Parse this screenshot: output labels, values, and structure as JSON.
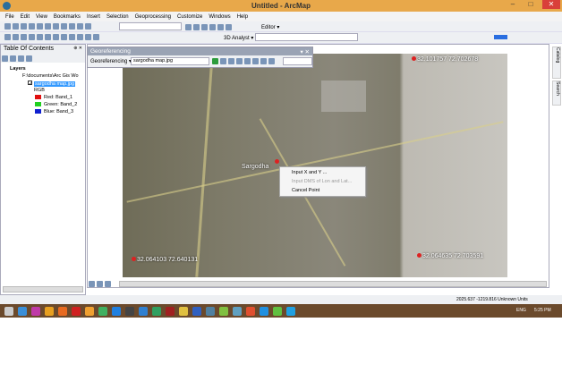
{
  "window": {
    "title": "Untitled - ArcMap",
    "min": "–",
    "max": "□",
    "close": "✕"
  },
  "menu": [
    "File",
    "Edit",
    "View",
    "Bookmarks",
    "Insert",
    "Selection",
    "Geoprocessing",
    "Customize",
    "Windows",
    "Help"
  ],
  "toolbars": {
    "editor_label": "Editor ▾",
    "analyst_label": "3D Analyst ▾"
  },
  "toc": {
    "title": "Table Of Contents",
    "pin": "⊕ ✕",
    "layers_label": "Layers",
    "folder": "F:\\documents\\Arc Gis Wo",
    "layer": "sargodha map.jpg",
    "rgb": "RGB",
    "bands": [
      {
        "label": "Red:  Band_1",
        "color": "#e01010"
      },
      {
        "label": "Green:  Band_2",
        "color": "#20d020"
      },
      {
        "label": "Blue:  Band_3",
        "color": "#1020d0"
      }
    ]
  },
  "georef": {
    "title": "Georeferencing",
    "menu_label": "Georeferencing ▾",
    "layer_select": "sargodha map.jpg"
  },
  "map": {
    "city_label": "Sargodha",
    "points": [
      "32.101757  72.702678",
      "32.064103  72.640131",
      "32.064635  72.703591"
    ]
  },
  "context_menu": [
    {
      "label": "Input X and Y ...",
      "enabled": true
    },
    {
      "label": "Input DMS of Lon and Lat...",
      "enabled": false
    },
    {
      "label": "Cancel Point",
      "enabled": true
    }
  ],
  "side_tabs": [
    "Catalog",
    "Search"
  ],
  "status": {
    "coords": "2025.637  -1219.816 Unknown Units"
  },
  "taskbar": {
    "lang": "ENG",
    "time": "5:25 PM",
    "icon_colors": [
      "#ccc",
      "#3a8fd8",
      "#3a8fd8",
      "#c03aa8",
      "#e8a020",
      "#e86a20",
      "#d02020",
      "#f0a030",
      "#40b060",
      "#2080e0",
      "#444",
      "#3080d0",
      "#30a060",
      "#a02020",
      "#e0c040",
      "#3060c0",
      "#5080a0",
      "#80c040",
      "#60a0c0",
      "#e05030",
      "#2090e0",
      "#60c040",
      "#20a0e0"
    ]
  }
}
